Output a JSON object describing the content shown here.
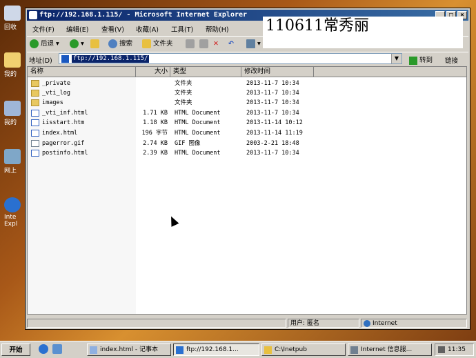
{
  "desktop": {
    "icons": [
      {
        "label": "回收"
      },
      {
        "label": "我的"
      },
      {
        "label": "我的"
      },
      {
        "label": "网上"
      },
      {
        "label": "Inte Expl"
      }
    ]
  },
  "window": {
    "title": "ftp://192.168.1.115/ - Microsoft Internet Explorer",
    "buttons": {
      "minimize": "_",
      "maximize": "□",
      "close": "×"
    }
  },
  "menu": [
    "文件(F)",
    "编辑(E)",
    "查看(V)",
    "收藏(A)",
    "工具(T)",
    "帮助(H)"
  ],
  "toolbar": {
    "back": "后退",
    "search": "搜索",
    "folders": "文件夹"
  },
  "address": {
    "label": "地址(D)",
    "value": "ftp://192.168.1.115/",
    "go": "转到",
    "links": "链接"
  },
  "overlay_text": "110611常秀丽",
  "columns": {
    "name": "名称",
    "size": "大小",
    "type": "类型",
    "modified": "修改时间"
  },
  "files": [
    {
      "name": "_private",
      "size": "",
      "type": "文件夹",
      "modified": "2013-11-7 10:34",
      "icon": "folder"
    },
    {
      "name": "_vti_log",
      "size": "",
      "type": "文件夹",
      "modified": "2013-11-7 10:34",
      "icon": "folder"
    },
    {
      "name": "images",
      "size": "",
      "type": "文件夹",
      "modified": "2013-11-7 10:34",
      "icon": "folder"
    },
    {
      "name": "_vti_inf.html",
      "size": "1.71 KB",
      "type": "HTML Document",
      "modified": "2013-11-7 10:34",
      "icon": "html"
    },
    {
      "name": "iisstart.htm",
      "size": "1.18 KB",
      "type": "HTML Document",
      "modified": "2013-11-14 10:12",
      "icon": "html"
    },
    {
      "name": "index.html",
      "size": "196 字节",
      "type": "HTML Document",
      "modified": "2013-11-14 11:19",
      "icon": "html"
    },
    {
      "name": "pagerror.gif",
      "size": "2.74 KB",
      "type": "GIF 图像",
      "modified": "2003-2-21 18:48",
      "icon": "gif"
    },
    {
      "name": "postinfo.html",
      "size": "2.39 KB",
      "type": "HTML Document",
      "modified": "2013-11-7 10:34",
      "icon": "html"
    }
  ],
  "status": {
    "user": "用户: 匿名",
    "zone": "Internet"
  },
  "taskbar": {
    "start": "开始",
    "tasks": [
      {
        "label": "index.html - 记事本"
      },
      {
        "label": "ftp://192.168.1..."
      },
      {
        "label": "C:\\Inetpub"
      },
      {
        "label": "Internet 信息服..."
      }
    ],
    "clock": "11:35"
  }
}
